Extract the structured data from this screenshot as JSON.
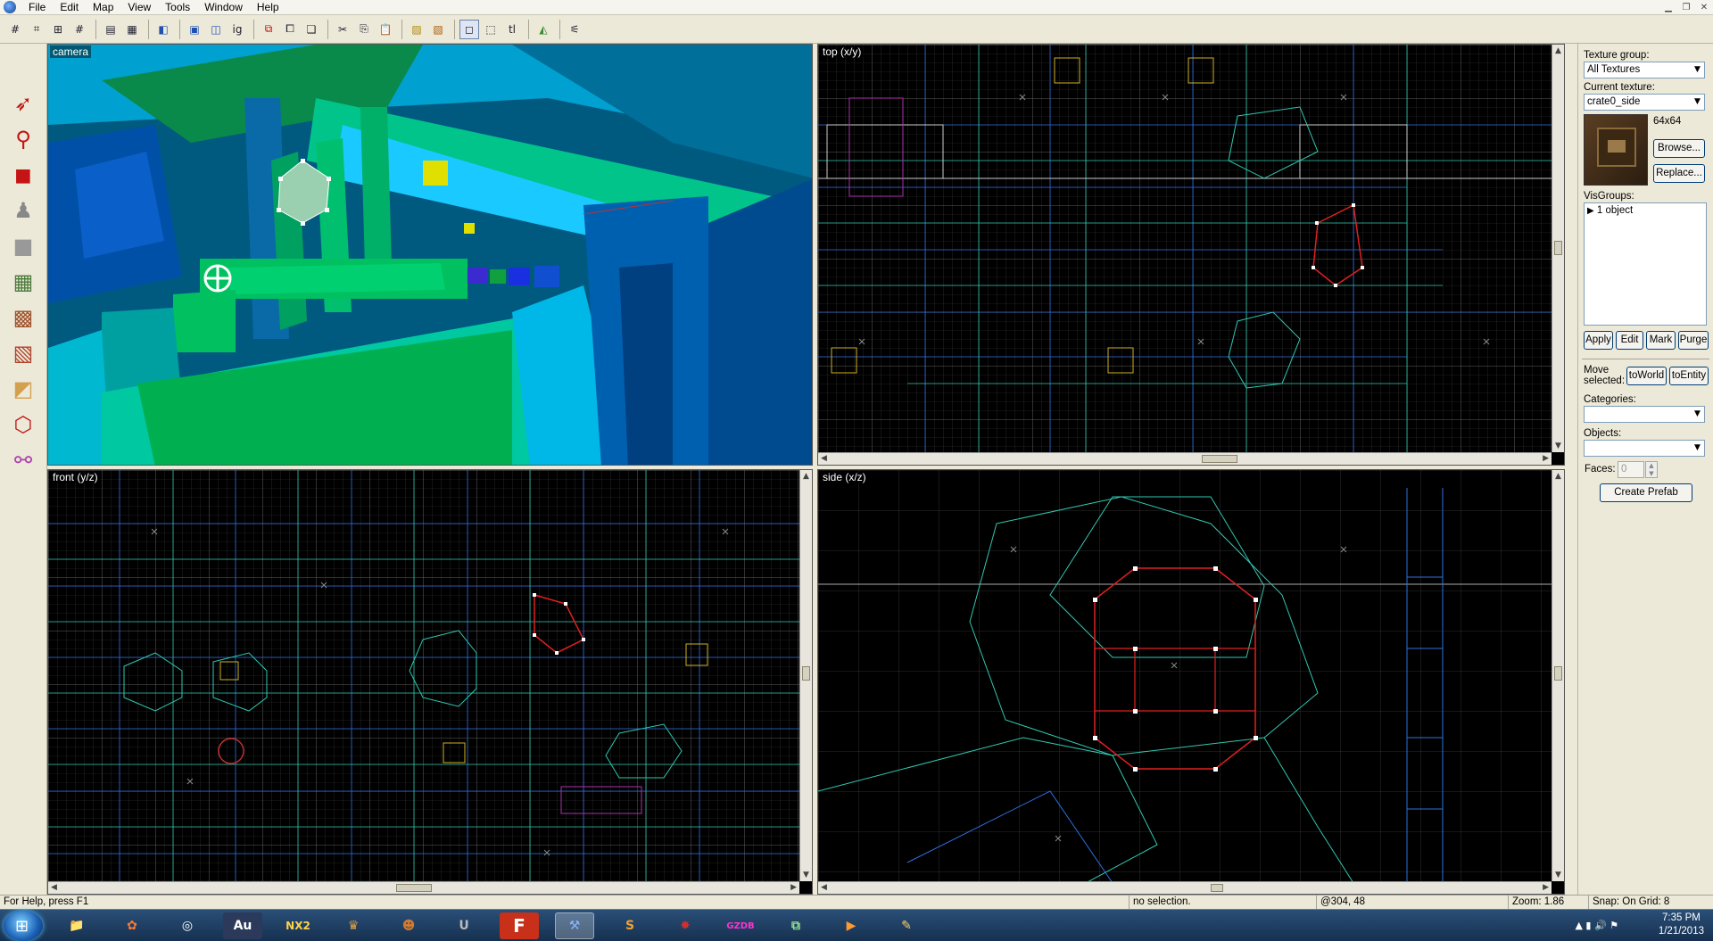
{
  "menu": {
    "items": [
      "File",
      "Edit",
      "Map",
      "View",
      "Tools",
      "Window",
      "Help"
    ]
  },
  "toolbar": {
    "icons": [
      "grid-toggle-icon",
      "3d-grid-icon",
      "smaller-grid-icon",
      "larger-grid-icon",
      "load-window-state-icon",
      "save-window-state-icon",
      "compile-icon",
      "carve-icon",
      "hollow-icon",
      "group-icon",
      "ungroup-icon",
      "undo-icon",
      "cut-icon",
      "copy-icon",
      "paste-icon",
      "texture-lock-icon",
      "texture-scale-lock-icon",
      "selection-tool-icon",
      "magnify-icon",
      "toggle-texture-icon",
      "clip-icon",
      "vertex-icon",
      "path-icon"
    ]
  },
  "viewports": {
    "camera": "camera",
    "top": "top (x/y)",
    "front": "front (y/z)",
    "side": "side (x/z)"
  },
  "panel": {
    "texture_group_label": "Texture group:",
    "texture_group_value": "All Textures",
    "current_texture_label": "Current texture:",
    "current_texture_value": "crate0_side",
    "texture_size": "64x64",
    "browse": "Browse...",
    "replace": "Replace...",
    "visgroups_label": "VisGroups:",
    "visgroup_item": "1 object",
    "apply": "Apply",
    "edit": "Edit",
    "mark": "Mark",
    "purge": "Purge",
    "move_selected": "Move selected:",
    "to_world": "toWorld",
    "to_entity": "toEntity",
    "categories_label": "Categories:",
    "objects_label": "Objects:",
    "faces_label": "Faces:",
    "faces_value": "0",
    "create_prefab": "Create Prefab"
  },
  "status": {
    "help": "For Help, press F1",
    "selection": "no selection.",
    "coords": "@304, 48",
    "zoom": "Zoom: 1.86",
    "snap": "Snap: On Grid: 8"
  },
  "taskbar": {
    "time": "7:35 PM",
    "date": "1/21/2013",
    "apps": [
      "explorer",
      "spring",
      "ecomponent",
      "Au",
      "NX2",
      "game-a",
      "game-b",
      "unreal",
      "F",
      "hammer",
      "game-c",
      "game-d",
      "GZDB",
      "network",
      "media",
      "paint"
    ]
  }
}
